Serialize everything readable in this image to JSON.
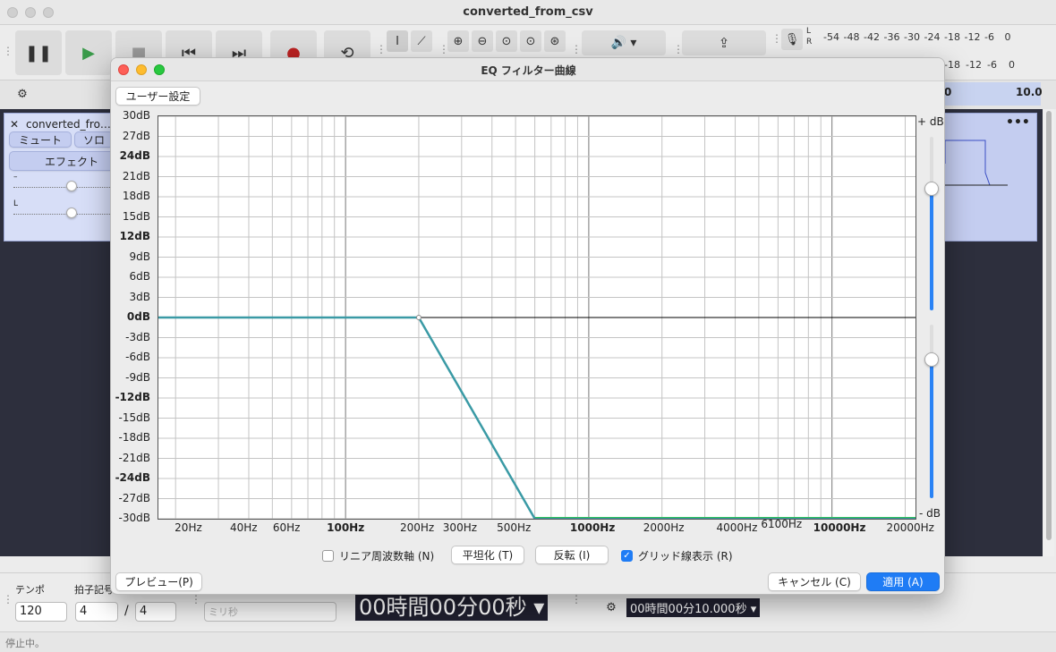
{
  "main_window": {
    "title": "converted_from_csv",
    "meter_scale": [
      "-54",
      "-48",
      "-42",
      "-36",
      "-30",
      "-24",
      "-18",
      "-12",
      "-6",
      "0"
    ],
    "meter_scale_out": [
      "-18",
      "-12",
      "-6",
      "0"
    ],
    "meter_l": "L",
    "meter_r": "R",
    "timeline_value": "10.0",
    "timeline_left": "0",
    "track": {
      "name": "converted_fro…",
      "mute_label": "ミュート",
      "solo_label": "ソロ",
      "effects_label": "エフェクト",
      "slider_minus": "–",
      "slider_l": "L"
    },
    "bottom": {
      "tempo_label": "テンポ",
      "time_sig_label": "拍子記号",
      "tempo_value": "120",
      "beats_value": "4",
      "slash": "/",
      "beat_unit_value": "4",
      "snap_unit": "ミリ秒",
      "big_time": "00時間00分00秒",
      "small_time": "00時間00分10.000秒"
    },
    "status": "停止中。"
  },
  "dialog": {
    "title": "EQ フィルター曲線",
    "user_settings_button": "ユーザー設定",
    "plus_db": "+ dB",
    "minus_db": "- dB",
    "linear_freq_label": "リニア周波数軸 (N)",
    "linear_freq_checked": false,
    "flatten_button": "平坦化 (T)",
    "invert_button": "反転 (I)",
    "grid_label": "グリッド線表示 (R)",
    "grid_checked": true,
    "preview_button": "プレビュー(P)",
    "cancel_button": "キャンセル (C)",
    "apply_button": "適用 (A)",
    "upper_slider_level": 0.3,
    "lower_slider_level": 0.2
  },
  "chart_data": {
    "type": "line",
    "title": "",
    "xlabel": "",
    "ylabel": "",
    "x_scale": "log",
    "xlim": [
      17,
      22050
    ],
    "ylim": [
      -30,
      30
    ],
    "grid": true,
    "x_ticks": [
      {
        "value": 20,
        "label": "20Hz",
        "bold": false
      },
      {
        "value": 40,
        "label": "40Hz",
        "bold": false
      },
      {
        "value": 60,
        "label": "60Hz",
        "bold": false
      },
      {
        "value": 100,
        "label": "100Hz",
        "bold": true
      },
      {
        "value": 200,
        "label": "200Hz",
        "bold": false
      },
      {
        "value": 300,
        "label": "300Hz",
        "bold": false
      },
      {
        "value": 500,
        "label": "500Hz",
        "bold": false
      },
      {
        "value": 1000,
        "label": "1000Hz",
        "bold": true
      },
      {
        "value": 2000,
        "label": "2000Hz",
        "bold": false
      },
      {
        "value": 4000,
        "label": "4000Hz",
        "bold": false
      },
      {
        "value": 6100,
        "label": "6100Hz",
        "bold": false
      },
      {
        "value": 10000,
        "label": "10000Hz",
        "bold": true
      },
      {
        "value": 20000,
        "label": "20000Hz",
        "bold": false
      }
    ],
    "y_ticks": [
      {
        "value": 30,
        "label": "30dB",
        "bold": false
      },
      {
        "value": 27,
        "label": "27dB",
        "bold": false
      },
      {
        "value": 24,
        "label": "24dB",
        "bold": true
      },
      {
        "value": 21,
        "label": "21dB",
        "bold": false
      },
      {
        "value": 18,
        "label": "18dB",
        "bold": false
      },
      {
        "value": 15,
        "label": "15dB",
        "bold": false
      },
      {
        "value": 12,
        "label": "12dB",
        "bold": true
      },
      {
        "value": 9,
        "label": "9dB",
        "bold": false
      },
      {
        "value": 6,
        "label": "6dB",
        "bold": false
      },
      {
        "value": 3,
        "label": "3dB",
        "bold": false
      },
      {
        "value": 0,
        "label": "0dB",
        "bold": true
      },
      {
        "value": -3,
        "label": "-3dB",
        "bold": false
      },
      {
        "value": -6,
        "label": "-6dB",
        "bold": false
      },
      {
        "value": -9,
        "label": "-9dB",
        "bold": false
      },
      {
        "value": -12,
        "label": "-12dB",
        "bold": true
      },
      {
        "value": -15,
        "label": "-15dB",
        "bold": false
      },
      {
        "value": -18,
        "label": "-18dB",
        "bold": false
      },
      {
        "value": -21,
        "label": "-21dB",
        "bold": false
      },
      {
        "value": -24,
        "label": "-24dB",
        "bold": true
      },
      {
        "value": -27,
        "label": "-27dB",
        "bold": false
      },
      {
        "value": -30,
        "label": "-30dB",
        "bold": false
      }
    ],
    "series": [
      {
        "color": "#3a9aa5",
        "x": [
          17,
          200,
          600,
          22050
        ],
        "y": [
          0,
          0,
          -30,
          -30
        ]
      }
    ],
    "colors": {
      "curve": "#3a9aa5",
      "floor": "#2ecc40"
    }
  }
}
